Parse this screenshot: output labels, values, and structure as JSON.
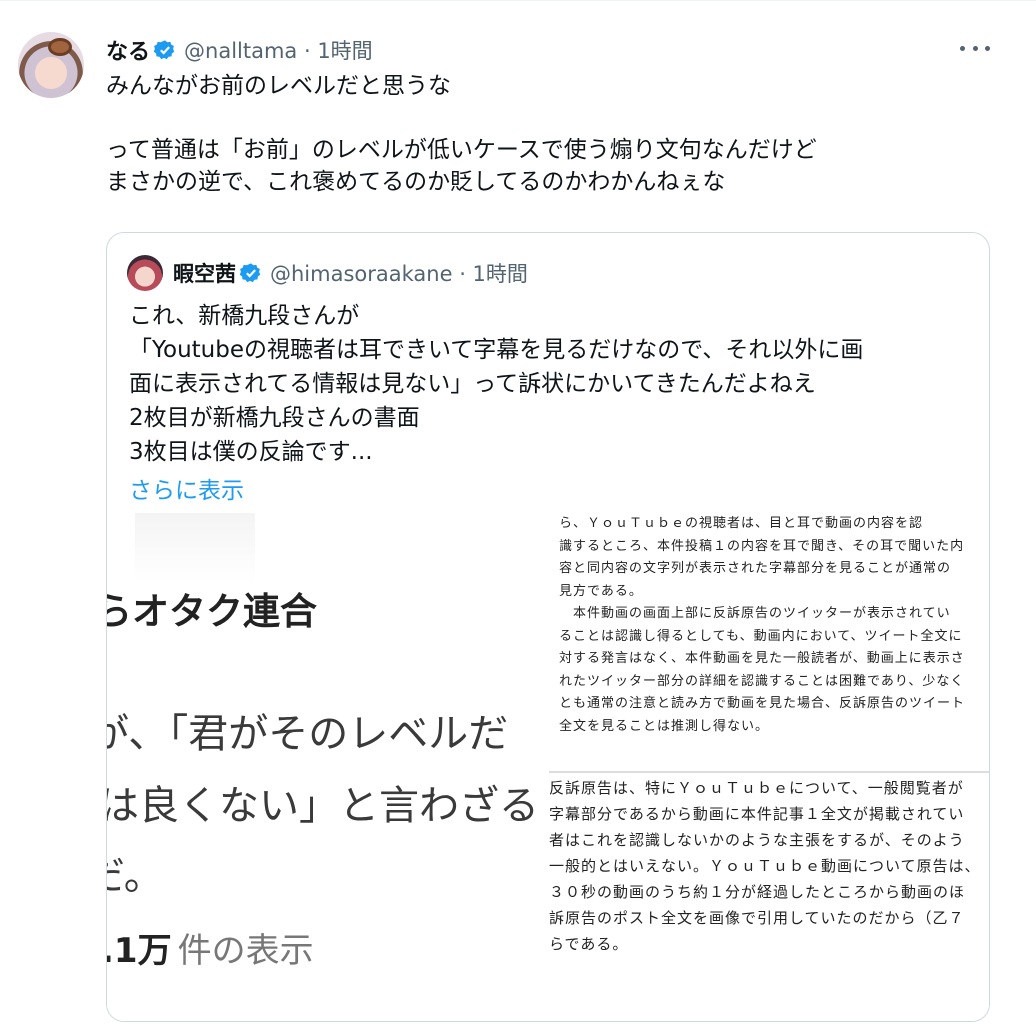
{
  "tweet": {
    "name": "なる",
    "handle": "@nalltama · 1時間",
    "lines": [
      "みんながお前のレベルだと思うな",
      "",
      "って普通は「お前」のレベルが低いケースで使う煽り文句なんだけど",
      "まさかの逆で、これ褒めてるのか貶してるのかわかんねぇな"
    ]
  },
  "quote": {
    "name": "暇空茜",
    "handle": "@himasoraakane · 1時間",
    "lines": [
      "これ、新橋九段さんが",
      "「Youtubeの視聴者は耳できいて字幕を見るだけなので、それ以外に画",
      "面に表示されてる情報は見ない」って訴状にかいてきたんだよねえ",
      "2枚目が新橋九段さんの書面",
      "3枚目は僕の反論です..."
    ],
    "show_more": "さらに表示"
  },
  "image_left": {
    "line1": "らオタク連合",
    "line2": "が、「君がそのレベルだ",
    "line3": "は良くない」と言わざる",
    "line4": "だ。",
    "views_number": ".1万",
    "views_label": "件の表示"
  },
  "image_right": {
    "doc1": [
      "ら、ＹｏｕＴｕｂｅの視聴者は、目と耳で動画の内容を認",
      "識するところ、本件投稿１の内容を耳で聞き、その耳で聞いた内",
      "容と同内容の文字列が表示された字幕部分を見ることが通常の",
      "見方である。",
      "　本件動画の画面上部に反訴原告のツイッターが表示されてい",
      "ることは認識し得るとしても、動画内において、ツイート全文に",
      "対する発言はなく、本件動画を見た一般読者が、動画上に表示さ",
      "れたツイッター部分の詳細を認識することは困難であり、少なく",
      "とも通常の注意と読み方で動画を見た場合、反訴原告のツイート",
      "全文を見ることは推測し得ない。"
    ],
    "doc2": [
      "反訴原告は、特にＹｏｕＴｕｂｅについて、一般閲覧者が",
      "字幕部分であるから動画に本件記事１全文が掲載されてい",
      "者はこれを認識しないかのような主張をするが、そのよう",
      "一般的とはいえない。ＹｏｕＴｕｂｅ動画について原告は、",
      "３０秒の動画のうち約１分が経過したところから動画のほ",
      "訴原告のポスト全文を画像で引用していたのだから（乙７",
      "らである。"
    ]
  },
  "colors": {
    "accent": "#1d9bf0",
    "secondary_text": "#536471",
    "border": "#cfd9de"
  },
  "icons": [
    "verified-badge-icon",
    "more-options-icon"
  ]
}
